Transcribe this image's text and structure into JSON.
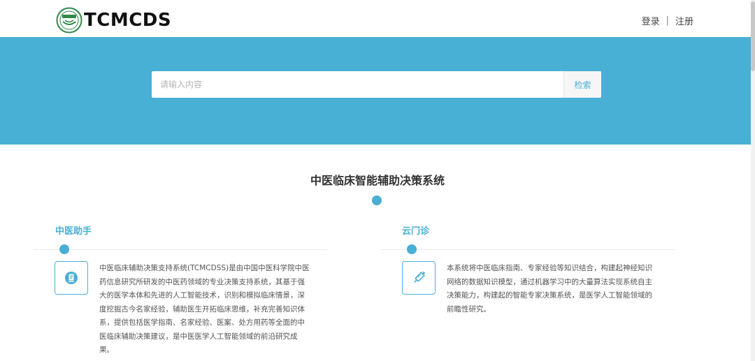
{
  "header": {
    "logo_text": "TCMCDS",
    "logo_icon": "tcm-emblem-icon",
    "login_label": "登录",
    "separator": "|",
    "register_label": "注册"
  },
  "search": {
    "placeholder": "请输入内容",
    "button_label": "检索"
  },
  "main": {
    "title": "中医临床智能辅助决策系统",
    "sections": [
      {
        "title": "中医助手",
        "icon": "document-icon",
        "text": "中医临床辅助决策支持系统(TCMCDSS)是由中国中医科学院中医药信息研究所研发的中医药领域的专业决策支持系统，其基于强大的医学本体和先进的人工智能技术，识别和模拟临床情景，深度挖掘古今名家经验，辅助医生开拓临床思维，补充完善知识体系，提供包括医学指南、名家经验、医案、处方用药等全面的中医临床辅助决策建议，是中医医学人工智能领域的前沿研究成果。"
      },
      {
        "title": "云门诊",
        "icon": "syringe-icon",
        "text": "本系统将中医临床指南、专家经验等知识结合，构建起神经知识网络的数据知识模型，通过机器学习中的大量算法实现系统自主决策能力，构建起的智能专家决策系统，是医学人工智能领域的前瞻性研究。"
      }
    ]
  },
  "colors": {
    "accent": "#48afd5",
    "text": "#333333"
  }
}
